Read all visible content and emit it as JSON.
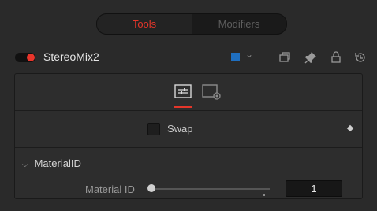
{
  "tabs": {
    "tools_label": "Tools",
    "modifiers_label": "Modifiers"
  },
  "node": {
    "name": "StereoMix2",
    "color": "#1f6fc0",
    "active_color": "#e8352b"
  },
  "toolbar_icons": [
    "versions-icon",
    "pin-icon",
    "lock-icon",
    "reset-icon"
  ],
  "panel": {
    "control_tabs": [
      "controls-icon",
      "settings-icon"
    ],
    "swap": {
      "label": "Swap",
      "checked": false
    },
    "section": {
      "title": "MaterialID",
      "expanded": true
    },
    "material_id": {
      "label": "Material ID",
      "value": "1",
      "slider_fraction": 0.0
    }
  },
  "accent_color": "#e4362a"
}
